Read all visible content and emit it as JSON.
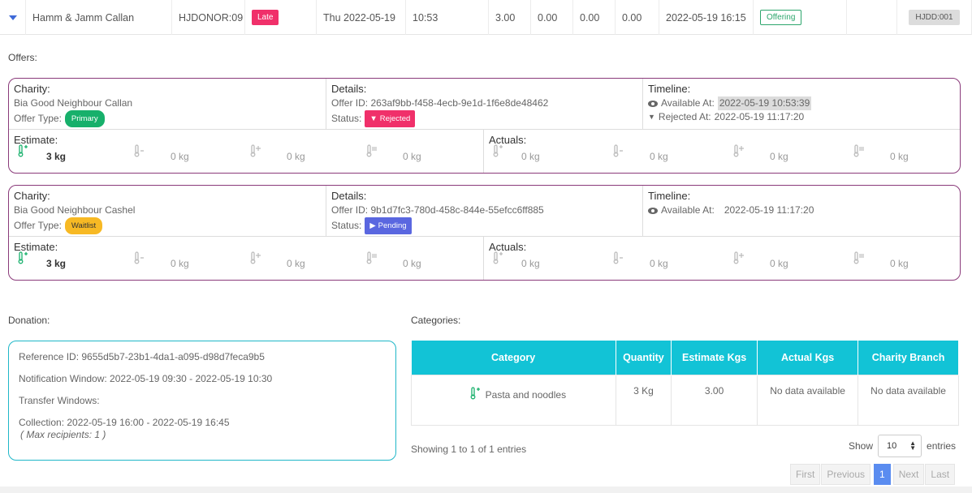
{
  "row": {
    "donor": "Hamm & Jamm Callan",
    "donor_code": "HJDONOR:09",
    "late_badge": "Late",
    "date": "Thu 2022-05-19",
    "time": "10:53",
    "v1": "3.00",
    "v2": "0.00",
    "v3": "0.00",
    "v4": "0.00",
    "created": "2022-05-19 16:15",
    "status": "Offering",
    "code": "HJDD:001"
  },
  "offers_label": "Offers:",
  "offers": [
    {
      "charity_header": "Charity:",
      "charity": "Bia Good Neighbour Callan",
      "offer_type_label": "Offer Type:",
      "offer_type": "Primary",
      "details_header": "Details:",
      "offer_id": "Offer ID: 263af9bb-f458-4ecb-9e1d-1f6e8de48462",
      "status_label": "Status:",
      "status": "Rejected",
      "timeline_header": "Timeline:",
      "available_label": "Available At:",
      "available": "2022-05-19 10:53:39",
      "rejected_label": "Rejected At:",
      "rejected": "2022-05-19 11:17:20",
      "estimate_header": "Estimate:",
      "estimate_vals": [
        "3 kg",
        "0 kg",
        "0 kg",
        "0 kg"
      ],
      "actuals_header": "Actuals:",
      "actual_vals": [
        "0 kg",
        "0 kg",
        "0 kg",
        "0 kg"
      ]
    },
    {
      "charity_header": "Charity:",
      "charity": "Bia Good Neighbour Cashel",
      "offer_type_label": "Offer Type:",
      "offer_type": "Waitlist",
      "details_header": "Details:",
      "offer_id": "Offer ID: 9b1d7fc3-780d-458c-844e-55efcc6ff885",
      "status_label": "Status:",
      "status": "Pending",
      "timeline_header": "Timeline:",
      "available_label": "Available At:",
      "available": "2022-05-19 11:17:20",
      "estimate_header": "Estimate:",
      "estimate_vals": [
        "3 kg",
        "0 kg",
        "0 kg",
        "0 kg"
      ],
      "actuals_header": "Actuals:",
      "actual_vals": [
        "0 kg",
        "0 kg",
        "0 kg",
        "0 kg"
      ]
    }
  ],
  "donation": {
    "label": "Donation:",
    "reference": "Reference ID: 9655d5b7-23b1-4da1-a095-d98d7feca9b5",
    "notification": "Notification Window: 2022-05-19 09:30 - 2022-05-19 10:30",
    "transfer": "Transfer Windows:",
    "collection": "Collection: 2022-05-19 16:00 - 2022-05-19 16:45",
    "max": "( Max recipients: 1 )"
  },
  "categories": {
    "label": "Categories:",
    "headers": [
      "Category",
      "Quantity",
      "Estimate Kgs",
      "Actual Kgs",
      "Charity Branch"
    ],
    "row": [
      "Pasta and noodles",
      "3 Kg",
      "3.00",
      "No data available",
      "No data available"
    ],
    "showing": "Showing 1 to 1 of 1 entries",
    "show_label": "Show",
    "page_size": "10",
    "entries_label": "entries",
    "pager": [
      "First",
      "Previous",
      "1",
      "Next",
      "Last"
    ]
  },
  "colors": {
    "accent": "#12c3d6",
    "card_border": "#8a3a7a",
    "late": "#f0306a",
    "primary": "#17b06b",
    "waitlist": "#f7b924",
    "pending": "#5a67e0"
  }
}
